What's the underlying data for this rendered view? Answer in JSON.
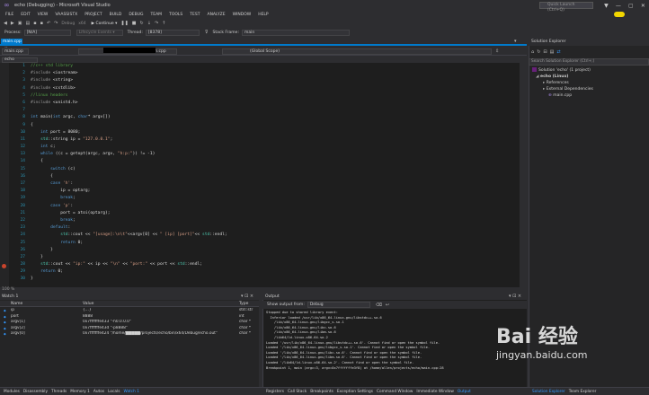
{
  "window": {
    "title": "echo (Debugging) - Microsoft Visual Studio",
    "quick_launch_placeholder": "Quick Launch (Ctrl+Q)",
    "controls": [
      "▼",
      "—",
      "▢",
      "✕"
    ]
  },
  "menu": [
    "FILE",
    "EDIT",
    "VIEW",
    "VAASSISTX",
    "PROJECT",
    "BUILD",
    "DEBUG",
    "TEAM",
    "TOOLS",
    "TEST",
    "ANALYZE",
    "WINDOW",
    "HELP"
  ],
  "toolbar": {
    "debug_config": "Debug",
    "platform": "x64",
    "continue_label": "▶ Continue ▾",
    "lifecycle_events": "Lifecycle Events ▾",
    "thread_label": "Thread:",
    "thread_value": "[8378]",
    "process_label": "Process:",
    "process_value": "[N/A]",
    "stack_frame_label": "Stack Frame:",
    "stack_frame_value": "main"
  },
  "editor": {
    "tab_label": "main.cpp",
    "tab_close": "×",
    "nav_project": "echo",
    "nav_scope": "(Global Scope)",
    "path_tail": "/echo/main.cpp",
    "path_short": "main.cpp",
    "line_numbers": [
      "1",
      "2",
      "3",
      "4",
      "5",
      "6",
      "7",
      "8",
      "9",
      "10",
      "11",
      "12",
      "13",
      "14",
      "15",
      "16",
      "17",
      "18",
      "19",
      "20",
      "21",
      "22",
      "23",
      "24",
      "25",
      "26",
      "27",
      "28",
      "29",
      "30"
    ],
    "code_lines": [
      "//c++ std library",
      "#include <iostream>",
      "#include <string>",
      "#include <cstdlib>",
      "//linux headers",
      "#include <unistd.h>",
      "",
      "int main(int argc, char* argv[])",
      "{",
      "    int port = 8080;",
      "    std::string ip = \"127.0.0.1\";",
      "    int c;",
      "    while ((c = getopt(argc, argv, \"h:p:\")) != -1)",
      "    {",
      "        switch (c)",
      "        {",
      "        case 'h':",
      "            ip = optarg;",
      "            break;",
      "        case 'p':",
      "            port = atoi(optarg);",
      "            break;",
      "        default:",
      "            std::cout << \"[usage]:\\n\\t\"<<argv[0] << \" [ip] [port]\"<< std::endl;",
      "            return 0;",
      "        }",
      "    }",
      "    std::cout << \"ip:\" << ip << \"\\n\" << \"port:\" << port << std::endl;",
      "    return 0;",
      "}"
    ]
  },
  "solution_explorer": {
    "title": "Solution Explorer",
    "search_placeholder": "Search Solution Explorer (Ctrl+;)",
    "items": [
      "Solution 'echo' (1 project)",
      "echo (Linux)",
      "References",
      "External Dependencies",
      "main.cpp"
    ]
  },
  "watch": {
    "title": "Watch 1",
    "headers": [
      "Name",
      "Value",
      "Type"
    ],
    "rows": [
      {
        "name": "ip",
        "value": "{...}",
        "type": "std::str"
      },
      {
        "name": "port",
        "value": "8888",
        "type": "int"
      },
      {
        "name": "argv[1]",
        "value": "0x7fffffffe433 \"-h0.0.0.0\"",
        "type": "char *"
      },
      {
        "name": "argv[2]",
        "value": "0x7fffffffe43d \"-p8888\"",
        "type": "char *"
      },
      {
        "name": "argv[0]",
        "value": "0x7fffffffe424 \"/home/█████/projects/echo/bin/x64/Debug/echo.out\"",
        "type": "char *"
      }
    ]
  },
  "output": {
    "title": "Output",
    "show_from_label": "Show output from:",
    "show_from_value": "Debug",
    "lines": [
      "Stopped due to shared library event:",
      "  Inferior loaded /usr/lib/x86_64-linux-gnu/libstdc++.so.6",
      "    /lib/x86_64-linux-gnu/libgcc_s.so.1",
      "    /lib/x86_64-linux-gnu/libc.so.6",
      "    /lib/x86_64-linux-gnu/libm.so.6",
      "    /lib64/ld-linux-x86-64.so.2",
      "Loaded '/usr/lib/x86_64-linux-gnu/libstdc++.so.6'. Cannot find or open the symbol file.",
      "Loaded '/lib/x86_64-linux-gnu/libgcc_s.so.1'. Cannot find or open the symbol file.",
      "Loaded '/lib/x86_64-linux-gnu/libc.so.6'. Cannot find or open the symbol file.",
      "Loaded '/lib/x86_64-linux-gnu/libm.so.6'. Cannot find or open the symbol file.",
      "Loaded '/lib64/ld-linux-x86-64.so.2'. Cannot find or open the symbol file.",
      "",
      "Breakpoint 1, main (argc=3, argv=0x7fffffffe3f8) at /home/allen/projects/echo/main.cpp:28"
    ]
  },
  "bottom_tabs_left": [
    "Modules",
    "Disassembly",
    "Threads",
    "Memory 1",
    "Autos",
    "Locals",
    "Watch 1"
  ],
  "bottom_tabs_mid": [
    "Registers",
    "Call Stack",
    "Breakpoints",
    "Exception Settings",
    "Command Window",
    "Immediate Window",
    "Output"
  ],
  "bottom_tabs_right": [
    "Solution Explorer",
    "Team Explorer"
  ],
  "watermark": {
    "brand": "Bai 经验",
    "url": "jingyan.baidu.com"
  },
  "colors": {
    "accent": "#007acc",
    "keyword": "#569cd6",
    "string": "#d69d85",
    "comment": "#57a64a",
    "preprocessor": "#9b9b9b",
    "breakpoint": "#c9442c",
    "user_badge": "#f2d600"
  }
}
